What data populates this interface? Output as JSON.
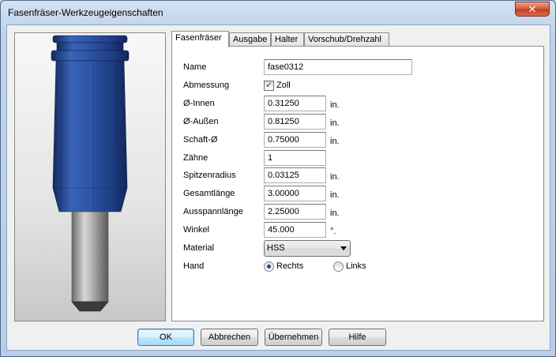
{
  "window": {
    "title": "Fasenfräser-Werkzeugeigenschaften",
    "close_glyph": "✕"
  },
  "tabs": [
    "Fasenfräser",
    "Ausgabe",
    "Halter",
    "Vorschub/Drehzahl"
  ],
  "form": {
    "name": {
      "label": "Name",
      "value": "fase0312"
    },
    "abmessung": {
      "label": "Abmessung",
      "checkbox_label": "Zoll",
      "checked": true
    },
    "fields": [
      {
        "label": "Ø-Innen",
        "value": "0.31250",
        "unit": "in."
      },
      {
        "label": "Ø-Außen",
        "value": "0.81250",
        "unit": "in."
      },
      {
        "label": "Schaft-Ø",
        "value": "0.75000",
        "unit": "in."
      },
      {
        "label": "Zähne",
        "value": "1",
        "unit": ""
      },
      {
        "label": "Spitzenradius",
        "value": "0.03125",
        "unit": "in."
      },
      {
        "label": "Gesamtlänge",
        "value": "3.00000",
        "unit": "in."
      },
      {
        "label": "Ausspannlänge",
        "value": "2.25000",
        "unit": "in."
      },
      {
        "label": "Winkel",
        "value": "45.000",
        "unit": "°."
      }
    ],
    "material": {
      "label": "Material",
      "value": "HSS"
    },
    "hand": {
      "label": "Hand",
      "options": [
        "Rechts",
        "Links"
      ],
      "selected": "Rechts"
    }
  },
  "buttons": {
    "ok": "OK",
    "cancel": "Abbrechen",
    "apply": "Übernehmen",
    "help": "Hilfe"
  },
  "colors": {
    "tool_body": "#2a4f9a",
    "tool_dark": "#1a2f66",
    "shank": "#9a9a9a"
  }
}
